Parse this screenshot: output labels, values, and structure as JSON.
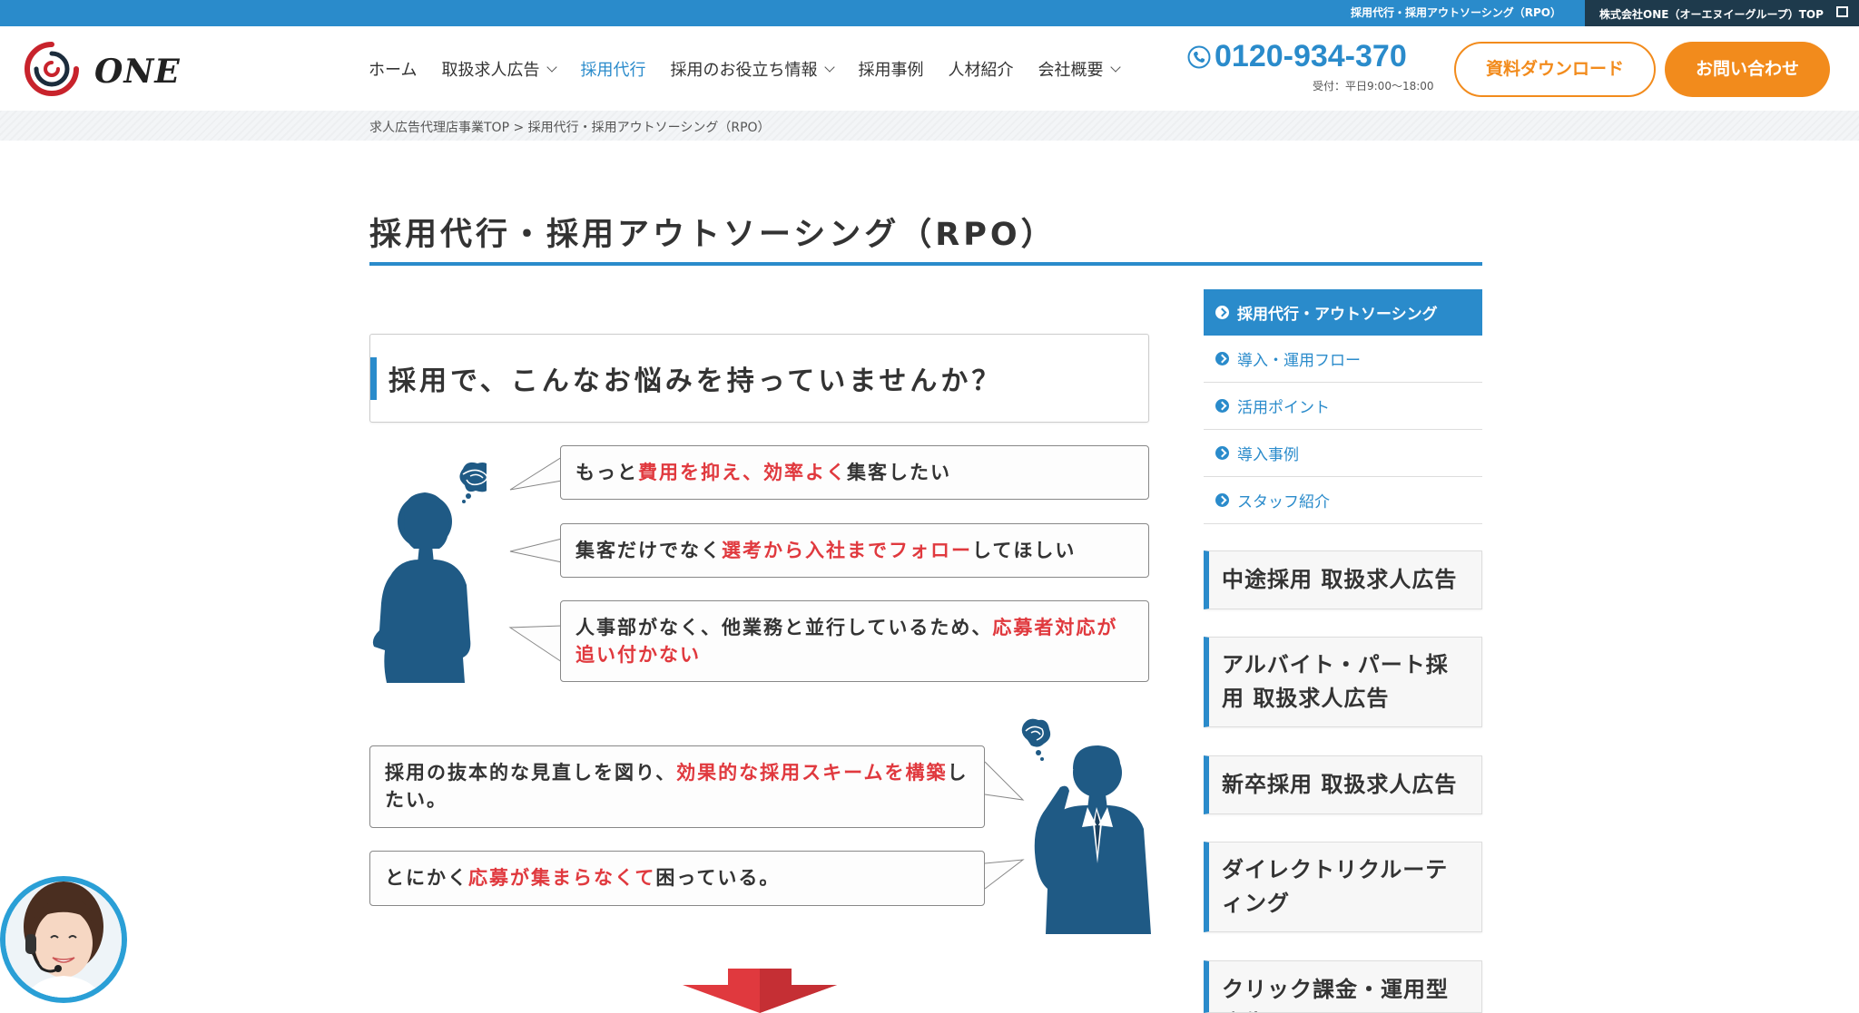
{
  "topbar": {
    "rpo_link": "採用代行・採用アウトソーシング（RPO）",
    "corp_link": "株式会社ONE（オーエヌイーグループ）TOP"
  },
  "header": {
    "logo_text": "ONE",
    "nav": [
      {
        "label": "ホーム",
        "dropdown": false,
        "active": false
      },
      {
        "label": "取扱求人広告",
        "dropdown": true,
        "active": false
      },
      {
        "label": "採用代行",
        "dropdown": false,
        "active": true
      },
      {
        "label": "採用のお役立ち情報",
        "dropdown": true,
        "active": false
      },
      {
        "label": "採用事例",
        "dropdown": false,
        "active": false
      },
      {
        "label": "人材紹介",
        "dropdown": false,
        "active": false
      },
      {
        "label": "会社概要",
        "dropdown": true,
        "active": false
      }
    ],
    "phone": "0120-934-370",
    "hours": "受付：平日9:00〜18:00",
    "download_label": "資料ダウンロード",
    "contact_label": "お問い合わせ"
  },
  "breadcrumb": "求人広告代理店事業TOP > 採用代行・採用アウトソーシング（RPO）",
  "page_title": "採用代行・採用アウトソーシング（RPO）",
  "worries": {
    "heading": "採用で、こんなお悩みを持っていませんか？",
    "bubbles": [
      {
        "pre": "もっと",
        "red": "費用を抑え、効率よく",
        "post": "集客したい"
      },
      {
        "pre": "集客だけでなく",
        "red": "選考から入社までフォロー",
        "post": "してほしい"
      },
      {
        "pre": "人事部がなく、他業務と並行しているため、",
        "red": "応募者対応が追い付かない",
        "post": ""
      },
      {
        "pre": "採用の抜本的な見直しを図り、",
        "red": "効果的な採用スキームを構築",
        "post": "したい。"
      },
      {
        "pre": "とにかく",
        "red": "応募が集まらなくて",
        "post": "困っている。"
      }
    ]
  },
  "sidebar": {
    "head": "採用代行・アウトソーシング",
    "items": [
      "導入・運用フロー",
      "活用ポイント",
      "導入事例",
      "スタッフ紹介"
    ],
    "cards": [
      "中途採用 取扱求人広告",
      "アルバイト・パート採用 取扱求人広告",
      "新卒採用 取扱求人広告",
      "ダイレクトリクルーティング",
      "クリック課金・運用型広告"
    ]
  },
  "colors": {
    "primary": "#2a8bcb",
    "accent_orange": "#f28b1c",
    "highlight_red": "#e0393e",
    "silhouette": "#1f5a85",
    "corp_bar": "#1e3a4c"
  }
}
